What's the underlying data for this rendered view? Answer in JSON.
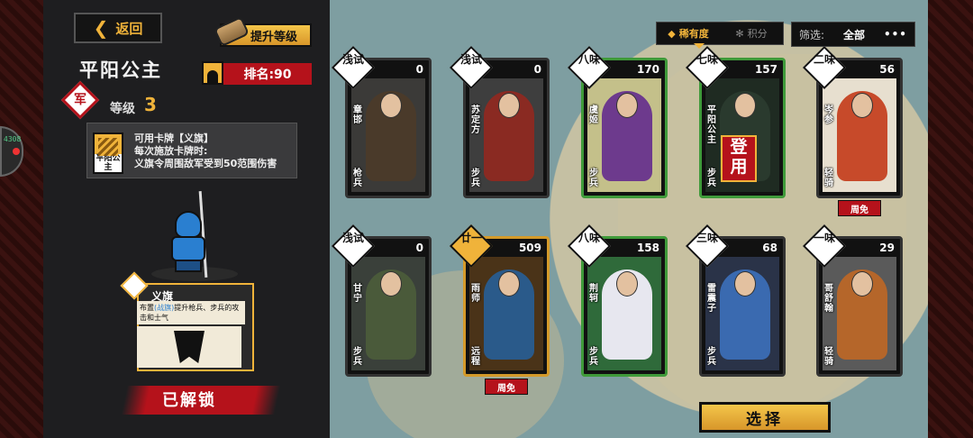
{
  "header": {
    "back_label": "返回",
    "upgrade_label": "提升等级"
  },
  "hero": {
    "name": "平阳公主",
    "rank_label": "排名:90",
    "army_badge": "军",
    "level_label": "等级",
    "level_value": "3",
    "skill": {
      "icon_label": "平阳公主",
      "line1": "可用卡牌【义旗】",
      "line2": "每次施放卡牌时:",
      "line3": "义旗令周围敌军受到50范围伤害"
    },
    "flag": {
      "title": "义旗",
      "desc_prefix": "布置",
      "desc_highlight": "(战旗)",
      "desc_suffix": "提升枪兵、步兵的攻击和士气"
    },
    "status": "已解锁"
  },
  "edge_tab": {
    "tag": "4308"
  },
  "filters": {
    "sort_rarity": "稀有度",
    "sort_points": "积分",
    "filter_label": "筛选:",
    "filter_value": "全部",
    "more": "•••"
  },
  "cards": [
    {
      "rarity": "浅试",
      "score": "0",
      "name": "章邯",
      "type": "枪兵",
      "border": "default",
      "bg": "#3b3a38",
      "fig": "#4a3a2a"
    },
    {
      "rarity": "浅试",
      "score": "0",
      "name": "苏定方",
      "type": "步兵",
      "border": "default",
      "bg": "#3e3e3e",
      "fig": "#8a2a22"
    },
    {
      "rarity": "八味",
      "score": "170",
      "name": "虞姬",
      "type": "步兵",
      "border": "green",
      "bg": "#c4c08a",
      "fig": "#6d3a8d"
    },
    {
      "rarity": "七味",
      "score": "157",
      "name": "平阳公主",
      "type": "步兵",
      "border": "green",
      "bg": "#1f2b22",
      "fig": "#2a3a2e"
    },
    {
      "rarity": "二味",
      "score": "56",
      "name": "岑参",
      "type": "轻骑",
      "border": "default",
      "bg": "#e7dfcf",
      "fig": "#c74a2a"
    },
    {
      "rarity": "浅试",
      "score": "0",
      "name": "甘宁",
      "type": "步兵",
      "border": "default",
      "bg": "#3a403a",
      "fig": "#4a5a3a"
    },
    {
      "rarity": "廿一",
      "score": "509",
      "name": "雨师",
      "type": "远程",
      "border": "gold",
      "bg": "#4a3318",
      "fig": "#2a5a8a"
    },
    {
      "rarity": "八味",
      "score": "158",
      "name": "荆轲",
      "type": "步兵",
      "border": "green",
      "bg": "#2f6a3a",
      "fig": "#e7e7ef"
    },
    {
      "rarity": "三味",
      "score": "68",
      "name": "雷震子",
      "type": "步兵",
      "border": "default",
      "bg": "#2a3348",
      "fig": "#3a6ab0"
    },
    {
      "rarity": "一味",
      "score": "29",
      "name": "哥舒翰",
      "type": "轻骑",
      "border": "default",
      "bg": "#5a5a5a",
      "fig": "#b5662a"
    }
  ],
  "weekly_free_label": "周免",
  "deployed_label": "登用",
  "select_label": "选择"
}
